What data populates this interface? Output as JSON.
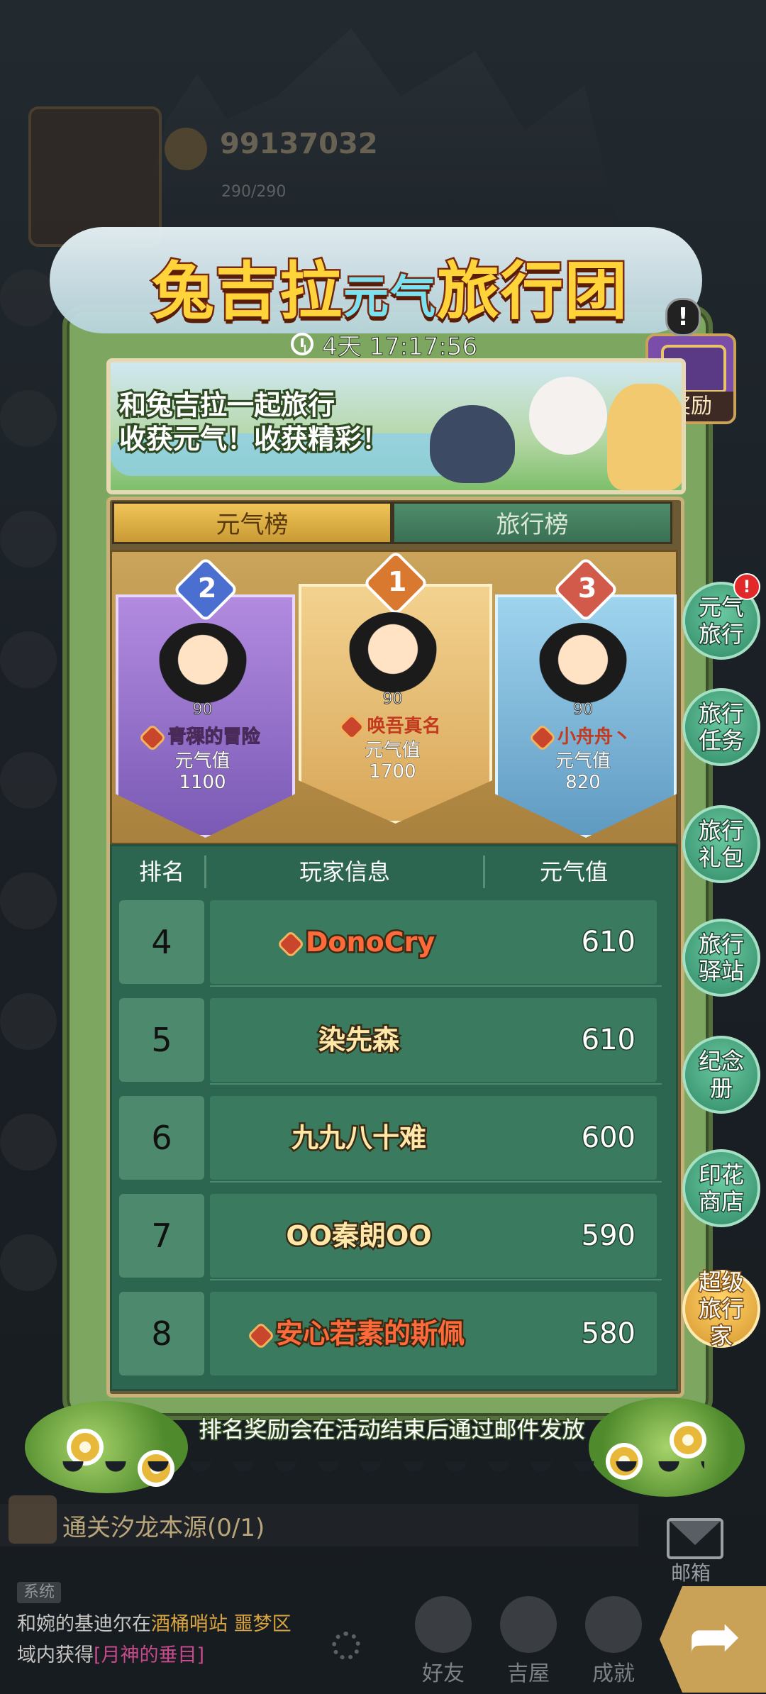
{
  "hud": {
    "currency": "99137032",
    "energy": "290/290"
  },
  "event": {
    "title_main_1": "兔吉拉",
    "title_small": "元气",
    "title_main_2": "旅行团",
    "timer": "4天 17:17:56",
    "banner_line1": "和兔吉拉一起旅行",
    "banner_line2": "收获元气！收获精彩！",
    "reward_label": "奖励",
    "alert": "!"
  },
  "tabs": [
    {
      "label": "元气榜",
      "active": true
    },
    {
      "label": "旅行榜",
      "active": false
    }
  ],
  "podium": [
    {
      "rank": "2",
      "level": "90",
      "name": "青稞的冒险",
      "value_label": "元气值",
      "value": "1100",
      "vip": true
    },
    {
      "rank": "1",
      "level": "90",
      "name": "唤吾真名",
      "value_label": "元气值",
      "value": "1700",
      "vip": true
    },
    {
      "rank": "3",
      "level": "90",
      "name": "小舟舟丶",
      "value_label": "元气值",
      "value": "820",
      "vip": true
    }
  ],
  "list": {
    "headers": {
      "rank": "排名",
      "player": "玩家信息",
      "value": "元气值"
    },
    "rows": [
      {
        "rank": "4",
        "name": "DonoCry",
        "value": "610",
        "vip": true
      },
      {
        "rank": "5",
        "name": "染先森",
        "value": "610",
        "vip": false
      },
      {
        "rank": "6",
        "name": "九九八十难",
        "value": "600",
        "vip": false
      },
      {
        "rank": "7",
        "name": "OO秦朗OO",
        "value": "590",
        "vip": false
      },
      {
        "rank": "8",
        "name": "安心若素的斯佩",
        "value": "580",
        "vip": true
      }
    ]
  },
  "footer_note": "排名奖励会在活动结束后通过邮件发放",
  "side_buttons": [
    {
      "label": "元气旅行",
      "alert": "!"
    },
    {
      "label": "旅行任务"
    },
    {
      "label": "旅行礼包"
    },
    {
      "label": "旅行驿站"
    },
    {
      "label": "纪念册"
    },
    {
      "label": "印花商店"
    },
    {
      "label": "超级旅行家"
    }
  ],
  "bottom": {
    "quest": "通关汐龙本源(0/1)",
    "mail": "邮箱",
    "system_tag": "系统",
    "system_msg_1": "和婉的基迪尔在",
    "system_loc_1": "酒桶哨站",
    "system_loc_2": "噩梦区",
    "system_msg_2": "域内获得",
    "system_item": "[月神的垂目]",
    "nav": [
      {
        "label": "好友"
      },
      {
        "label": "吉屋"
      },
      {
        "label": "成就"
      }
    ]
  },
  "colors": {
    "panel_green": "#7da760",
    "list_green": "#2d6650",
    "tab_gold": "#f0c558",
    "vip_name": "#ff6a3a",
    "normal_name": "#ffe7a8"
  }
}
